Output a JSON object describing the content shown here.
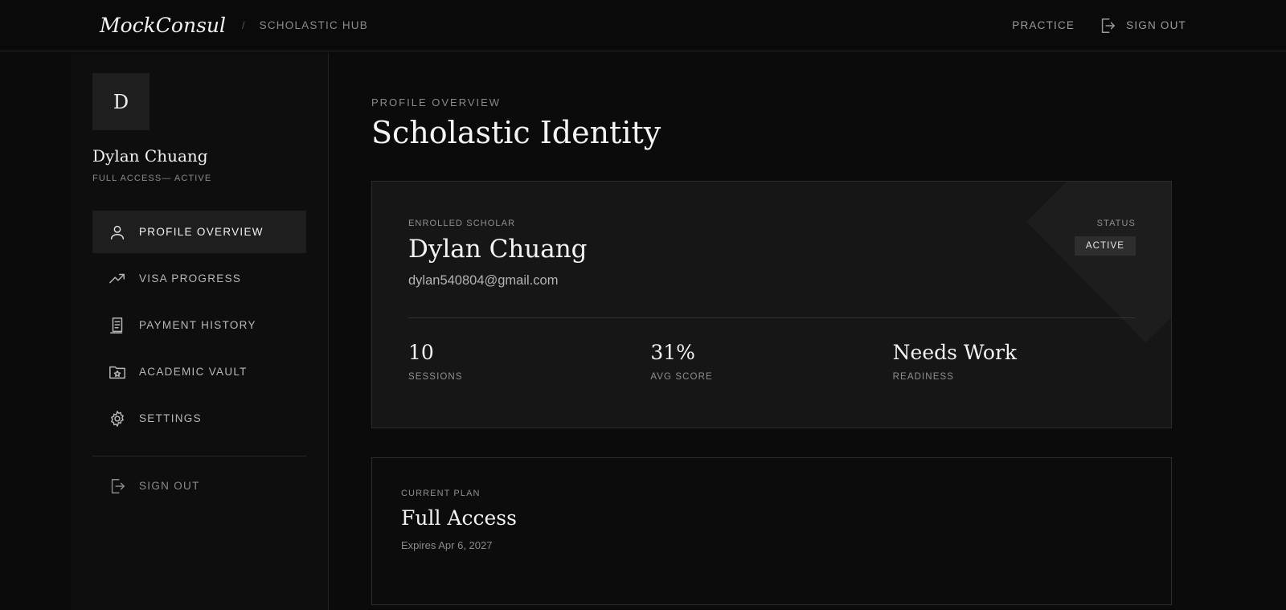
{
  "topbar": {
    "brand": "MockConsul",
    "separator": "/",
    "crumb": "SCHOLASTIC HUB",
    "practice_label": "PRACTICE",
    "signout_label": "SIGN OUT"
  },
  "sidebar": {
    "avatar_initial": "D",
    "user_name": "Dylan Chuang",
    "user_status": "FULL ACCESS— ACTIVE",
    "items": [
      {
        "label": "PROFILE OVERVIEW",
        "icon": "user-icon",
        "active": true
      },
      {
        "label": "VISA PROGRESS",
        "icon": "trending-up-icon",
        "active": false
      },
      {
        "label": "PAYMENT HISTORY",
        "icon": "receipt-icon",
        "active": false
      },
      {
        "label": "ACADEMIC VAULT",
        "icon": "folder-star-icon",
        "active": false
      },
      {
        "label": "SETTINGS",
        "icon": "gear-icon",
        "active": false
      }
    ],
    "signout_label": "SIGN OUT"
  },
  "main": {
    "eyebrow": "PROFILE OVERVIEW",
    "title": "Scholastic Identity",
    "scholar_card": {
      "label": "ENROLLED SCHOLAR",
      "name": "Dylan Chuang",
      "email": "dylan540804@gmail.com",
      "status_label": "STATUS",
      "status_value": "ACTIVE",
      "stats": [
        {
          "value": "10",
          "label": "SESSIONS"
        },
        {
          "value": "31%",
          "label": "AVG SCORE"
        },
        {
          "value": "Needs Work",
          "label": "READINESS"
        }
      ]
    },
    "plan_card": {
      "label": "CURRENT PLAN",
      "name": "Full Access",
      "expires": "Expires Apr 6, 2027"
    }
  },
  "colors": {
    "background": "#0b0b0b",
    "sidebar": "#0e0e0e",
    "card": "#161616",
    "active_item": "#1e1e1e",
    "badge": "#2e2e2e"
  }
}
